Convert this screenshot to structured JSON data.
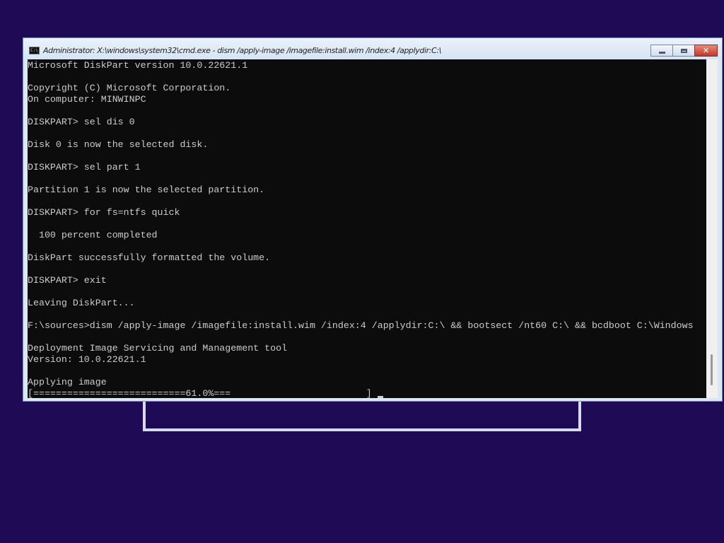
{
  "window": {
    "title": "Administrator: X:\\windows\\system32\\cmd.exe - dism  /apply-image /imagefile:install.wim /index:4 /applydir:C:\\",
    "icon_label": "C:\\",
    "minimize_icon": "minimize-icon",
    "maximize_icon": "maximize-icon",
    "close_icon": "close-icon",
    "close_glyph": "✕"
  },
  "console": {
    "lines": [
      "Microsoft DiskPart version 10.0.22621.1",
      "",
      "Copyright (C) Microsoft Corporation.",
      "On computer: MINWINPC",
      "",
      "DISKPART> sel dis 0",
      "",
      "Disk 0 is now the selected disk.",
      "",
      "DISKPART> sel part 1",
      "",
      "Partition 1 is now the selected partition.",
      "",
      "DISKPART> for fs=ntfs quick",
      "",
      "  100 percent completed",
      "",
      "DiskPart successfully formatted the volume.",
      "",
      "DISKPART> exit",
      "",
      "Leaving DiskPart...",
      "",
      "F:\\sources>dism /apply-image /imagefile:install.wim /index:4 /applydir:C:\\ && bootsect /nt60 C:\\ && bcdboot C:\\Windows",
      "",
      "Deployment Image Servicing and Management tool",
      "Version: 10.0.22621.1",
      "",
      "Applying image"
    ],
    "progress_line": "[===========================61.0%===                        ] ",
    "progress_percent": 61.0
  }
}
